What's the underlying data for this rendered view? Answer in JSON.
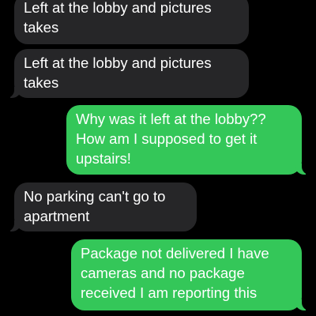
{
  "thread": {
    "messages": [
      {
        "direction": "incoming",
        "text": "Left at the lobby and pictures takes"
      },
      {
        "direction": "incoming",
        "text": "Left at the lobby and pictures takes"
      },
      {
        "direction": "outgoing",
        "text": "Why was it left at the lobby?? How am I supposed to get it upstairs!"
      },
      {
        "direction": "incoming",
        "text": "No parking can't go to apartment"
      },
      {
        "direction": "outgoing",
        "text": "Package not delivered I have cameras and no package received I am reporting this"
      }
    ]
  },
  "colors": {
    "background": "#000000",
    "incoming_bubble": "#262628",
    "outgoing_bubble": "#34c759",
    "text": "#ffffff"
  }
}
